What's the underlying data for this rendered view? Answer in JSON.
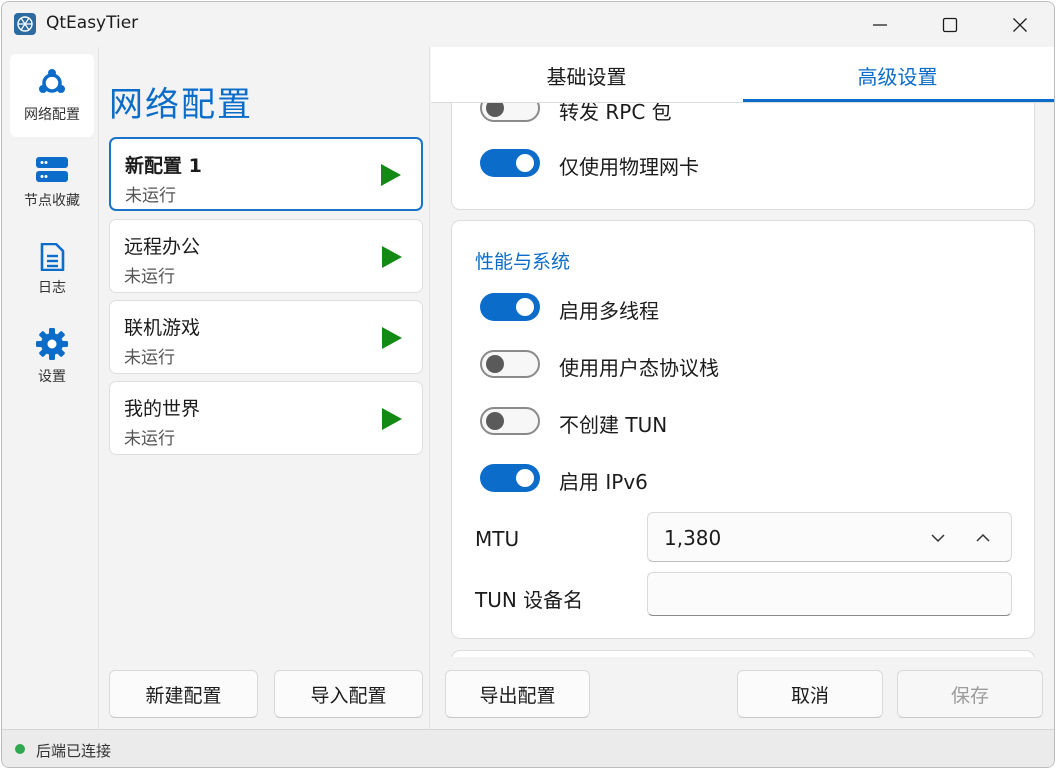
{
  "window": {
    "title": "QtEasyTier"
  },
  "nav": {
    "items": [
      {
        "label": "网络配置",
        "icon": "network-icon"
      },
      {
        "label": "节点收藏",
        "icon": "server-icon"
      },
      {
        "label": "日志",
        "icon": "document-icon"
      },
      {
        "label": "设置",
        "icon": "gear-icon"
      }
    ]
  },
  "list": {
    "title": "网络配置",
    "configs": [
      {
        "name": "新配置 1",
        "status": "未运行"
      },
      {
        "name": "远程办公",
        "status": "未运行"
      },
      {
        "name": "联机游戏",
        "status": "未运行"
      },
      {
        "name": "我的世界",
        "status": "未运行"
      }
    ],
    "new_button": "新建配置",
    "import_button": "导入配置"
  },
  "tabs": {
    "basic": "基础设置",
    "advanced": "高级设置"
  },
  "advanced": {
    "partial_toggle_label": "转发 RPC 包",
    "physical_nic_label": "仅使用物理网卡",
    "perf_section_title": "性能与系统",
    "multithread_label": "启用多线程",
    "userspace_stack_label": "使用用户态协议栈",
    "no_tun_label": "不创建 TUN",
    "ipv6_label": "启用 IPv6",
    "mtu_label": "MTU",
    "mtu_value": "1,380",
    "tun_name_label": "TUN 设备名",
    "tun_name_value": ""
  },
  "toggles": {
    "forward_rpc": false,
    "physical_nic_only": true,
    "multithread": true,
    "userspace_stack": false,
    "no_tun": false,
    "ipv6": true
  },
  "footer": {
    "export_button": "导出配置",
    "cancel_button": "取消",
    "save_button": "保存"
  },
  "status": {
    "text": "后端已连接",
    "color": "#2fa84f"
  },
  "colors": {
    "accent": "#0b6cc9",
    "play": "#138a13"
  }
}
